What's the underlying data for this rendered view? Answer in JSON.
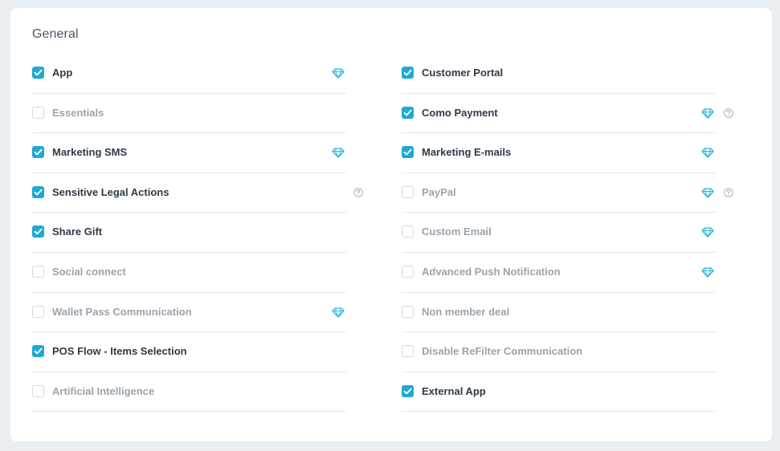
{
  "section": {
    "title": "General"
  },
  "colors": {
    "accent": "#1fa8d4",
    "gem": "#29b6d9"
  },
  "left_items": [
    {
      "label": "App",
      "checked": true,
      "premium": true,
      "help": false
    },
    {
      "label": "Essentials",
      "checked": false,
      "premium": false,
      "help": false
    },
    {
      "label": "Marketing SMS",
      "checked": true,
      "premium": true,
      "help": false
    },
    {
      "label": "Sensitive Legal Actions",
      "checked": true,
      "premium": false,
      "help": true
    },
    {
      "label": "Share Gift",
      "checked": true,
      "premium": false,
      "help": false
    },
    {
      "label": "Social connect",
      "checked": false,
      "premium": false,
      "help": false
    },
    {
      "label": "Wallet Pass Communication",
      "checked": false,
      "premium": true,
      "help": false
    },
    {
      "label": "POS Flow - Items Selection",
      "checked": true,
      "premium": false,
      "help": false
    },
    {
      "label": "Artificial Intelligence",
      "checked": false,
      "premium": false,
      "help": false
    }
  ],
  "right_items": [
    {
      "label": "Customer Portal",
      "checked": true,
      "premium": false,
      "help": false
    },
    {
      "label": "Como Payment",
      "checked": true,
      "premium": true,
      "help": true
    },
    {
      "label": "Marketing E-mails",
      "checked": true,
      "premium": true,
      "help": false
    },
    {
      "label": "PayPal",
      "checked": false,
      "premium": true,
      "help": true
    },
    {
      "label": "Custom Email",
      "checked": false,
      "premium": true,
      "help": false
    },
    {
      "label": "Advanced Push Notification",
      "checked": false,
      "premium": true,
      "help": false
    },
    {
      "label": "Non member deal",
      "checked": false,
      "premium": false,
      "help": false
    },
    {
      "label": "Disable ReFilter Communication",
      "checked": false,
      "premium": false,
      "help": false
    },
    {
      "label": "External App",
      "checked": true,
      "premium": false,
      "help": false
    }
  ]
}
